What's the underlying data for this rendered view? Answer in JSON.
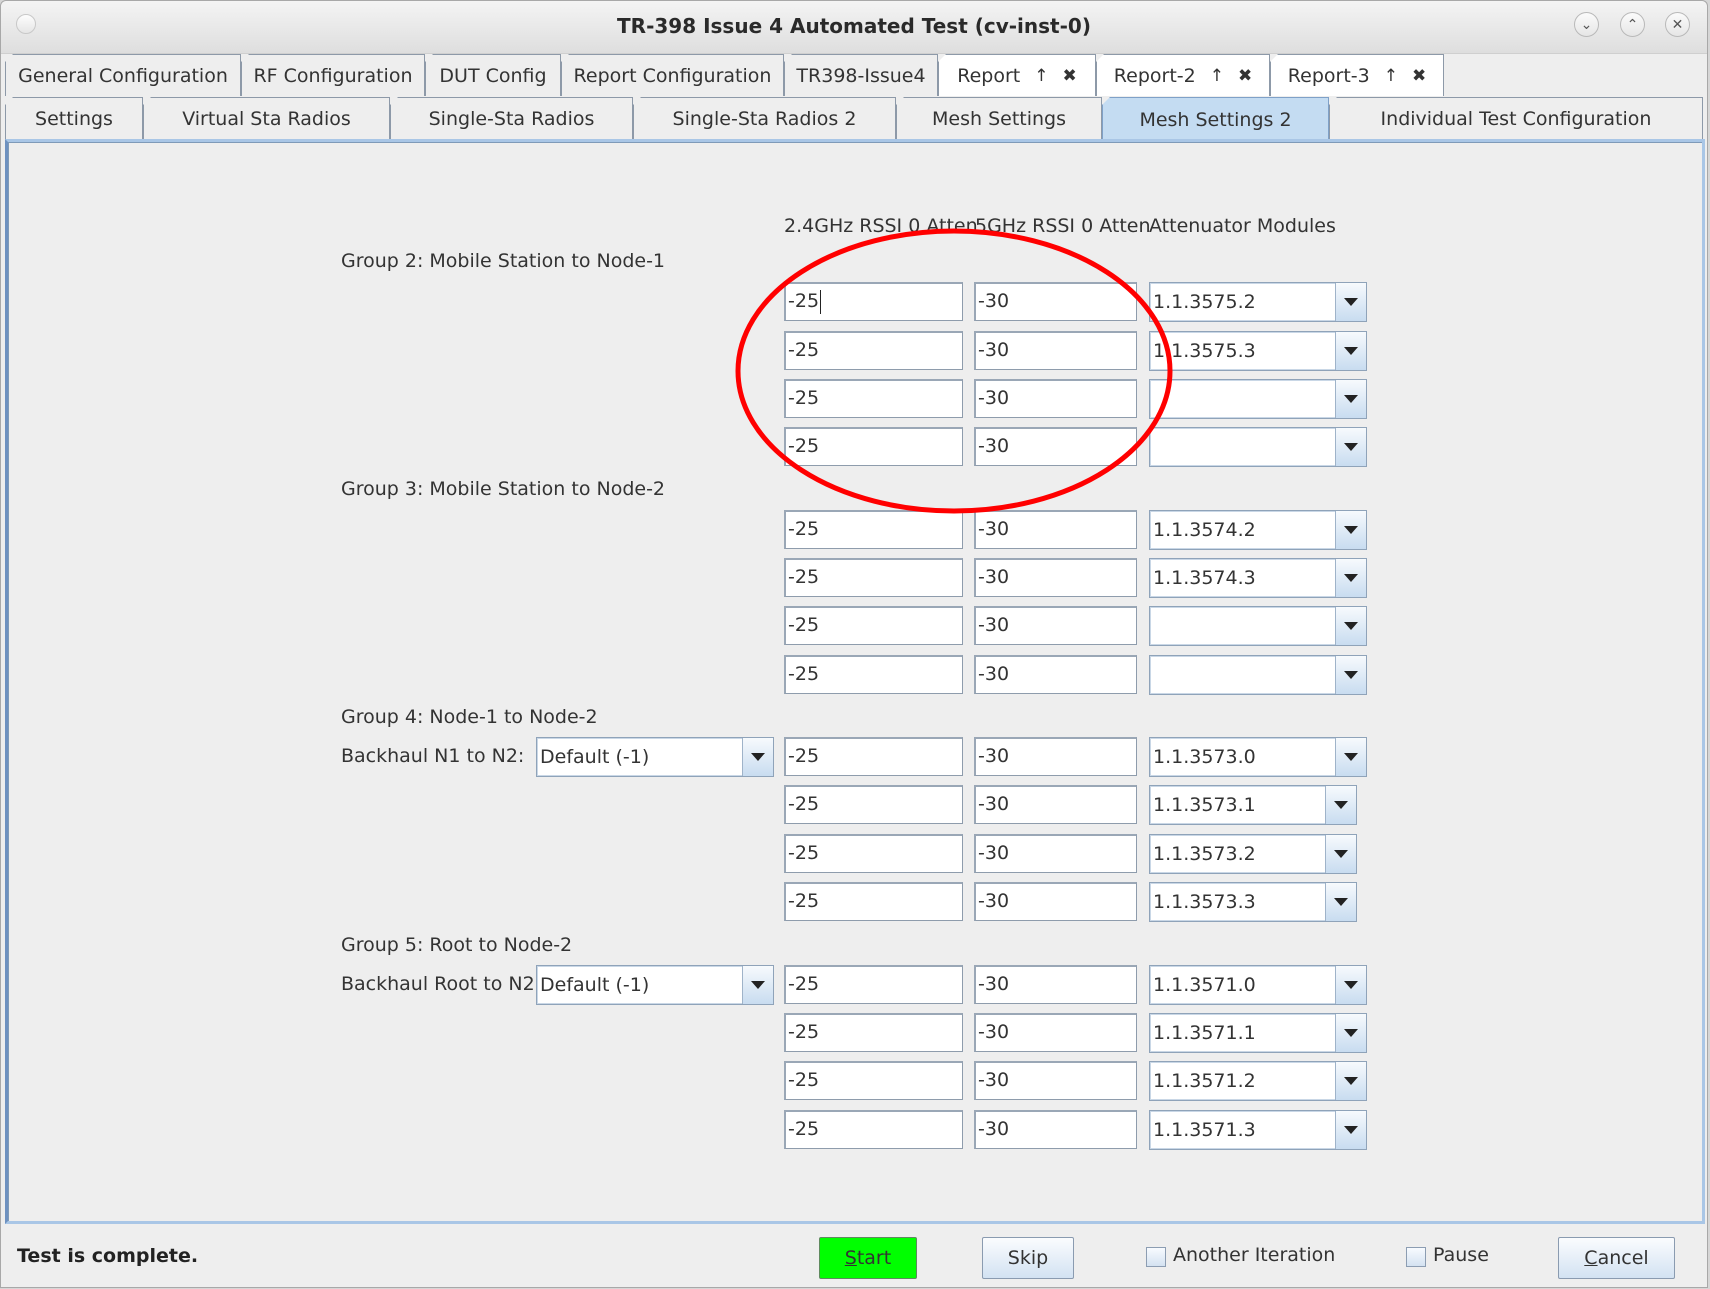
{
  "window": {
    "title": "TR-398 Issue 4 Automated Test  (cv-inst-0)",
    "controls": [
      "minimize",
      "maximize",
      "close"
    ]
  },
  "tabs_row1": [
    {
      "label": "General Configuration"
    },
    {
      "label": "RF Configuration"
    },
    {
      "label": "DUT Config"
    },
    {
      "label": "Report Configuration"
    },
    {
      "label": "TR398-Issue4"
    },
    {
      "label": "Report",
      "detachable": true,
      "closable": true
    },
    {
      "label": "Report-2",
      "detachable": true,
      "closable": true
    },
    {
      "label": "Report-3",
      "detachable": true,
      "closable": true
    }
  ],
  "tabs_row2": [
    {
      "label": "Settings"
    },
    {
      "label": "Virtual Sta Radios"
    },
    {
      "label": "Single-Sta Radios"
    },
    {
      "label": "Single-Sta Radios 2"
    },
    {
      "label": "Mesh Settings"
    },
    {
      "label": "Mesh Settings 2",
      "active": true
    },
    {
      "label": "Individual Test Configuration"
    }
  ],
  "icons": {
    "detach": "↑",
    "close_tab": "✖",
    "minimize": "⌄",
    "maximize": "⌃",
    "close": "✕"
  },
  "columns": {
    "rssi24": "2.4GHz RSSI 0 Atten",
    "rssi5": "5GHz RSSI 0 Atten",
    "modules": "Attenuator Modules"
  },
  "groups": [
    {
      "label": "Group 2: Mobile Station to Node-1",
      "rows": [
        {
          "rssi24": "-25",
          "rssi5": "-30",
          "module": "1.1.3575.2"
        },
        {
          "rssi24": "-25",
          "rssi5": "-30",
          "module": "1.1.3575.3"
        },
        {
          "rssi24": "-25",
          "rssi5": "-30",
          "module": ""
        },
        {
          "rssi24": "-25",
          "rssi5": "-30",
          "module": ""
        }
      ]
    },
    {
      "label": "Group 3: Mobile Station to Node-2",
      "rows": [
        {
          "rssi24": "-25",
          "rssi5": "-30",
          "module": "1.1.3574.2"
        },
        {
          "rssi24": "-25",
          "rssi5": "-30",
          "module": "1.1.3574.3"
        },
        {
          "rssi24": "-25",
          "rssi5": "-30",
          "module": ""
        },
        {
          "rssi24": "-25",
          "rssi5": "-30",
          "module": ""
        }
      ]
    },
    {
      "label": "Group 4: Node-1 to Node-2",
      "backhaul_label": "Backhaul N1 to N2:",
      "backhaul_value": "Default (-1)",
      "rows": [
        {
          "rssi24": "-25",
          "rssi5": "-30",
          "module": "1.1.3573.0"
        },
        {
          "rssi24": "-25",
          "rssi5": "-30",
          "module": "1.1.3573.1"
        },
        {
          "rssi24": "-25",
          "rssi5": "-30",
          "module": "1.1.3573.2"
        },
        {
          "rssi24": "-25",
          "rssi5": "-30",
          "module": "1.1.3573.3"
        }
      ]
    },
    {
      "label": "Group 5: Root to Node-2",
      "backhaul_label": "Backhaul Root to N2:",
      "backhaul_value": "Default (-1)",
      "rows": [
        {
          "rssi24": "-25",
          "rssi5": "-30",
          "module": "1.1.3571.0"
        },
        {
          "rssi24": "-25",
          "rssi5": "-30",
          "module": "1.1.3571.1"
        },
        {
          "rssi24": "-25",
          "rssi5": "-30",
          "module": "1.1.3571.2"
        },
        {
          "rssi24": "-25",
          "rssi5": "-30",
          "module": "1.1.3571.3"
        }
      ]
    }
  ],
  "footer": {
    "status": "Test is complete.",
    "start_label": "Start",
    "start_mnemonic": "S",
    "start_rest": "tart",
    "start_color": "#00ff00",
    "skip_label": "Skip",
    "another_iteration_label": "Another Iteration",
    "another_iteration_checked": false,
    "pause_label": "Pause",
    "pause_checked": false,
    "cancel_label": "Cancel",
    "cancel_mnemonic": "C",
    "cancel_rest": "ancel"
  },
  "annotation": {
    "shape": "ellipse",
    "color": "#ff0000"
  }
}
